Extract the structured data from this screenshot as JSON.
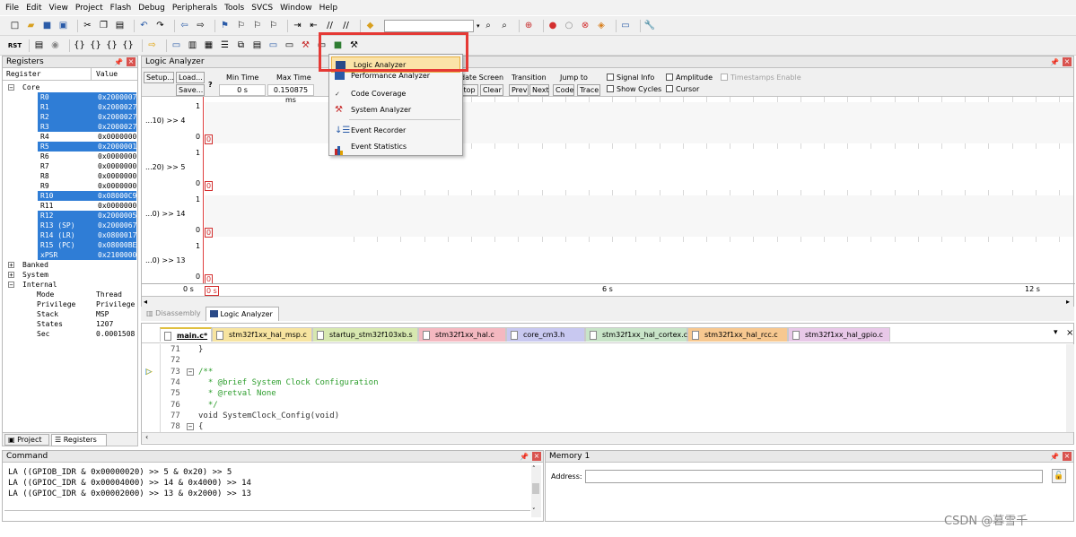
{
  "menu": [
    "File",
    "Edit",
    "View",
    "Project",
    "Flash",
    "Debug",
    "Peripherals",
    "Tools",
    "SVCS",
    "Window",
    "Help"
  ],
  "registers": {
    "title": "Registers",
    "col_register": "Register",
    "col_value": "Value",
    "group_core": "Core",
    "rows": [
      {
        "name": "R0",
        "value": "0x2000007",
        "selected": true
      },
      {
        "name": "R1",
        "value": "0x2000027",
        "selected": true
      },
      {
        "name": "R2",
        "value": "0x2000027",
        "selected": true
      },
      {
        "name": "R3",
        "value": "0x2000027",
        "selected": true
      },
      {
        "name": "R4",
        "value": "0x0000000",
        "selected": false
      },
      {
        "name": "R5",
        "value": "0x2000001",
        "selected": true
      },
      {
        "name": "R6",
        "value": "0x0000000",
        "selected": false
      },
      {
        "name": "R7",
        "value": "0x0000000",
        "selected": false
      },
      {
        "name": "R8",
        "value": "0x0000000",
        "selected": false
      },
      {
        "name": "R9",
        "value": "0x0000000",
        "selected": false
      },
      {
        "name": "R10",
        "value": "0x08000C9",
        "selected": true
      },
      {
        "name": "R11",
        "value": "0x0000000",
        "selected": false
      },
      {
        "name": "R12",
        "value": "0x2000005",
        "selected": true
      },
      {
        "name": "R13 (SP)",
        "value": "0x2000067",
        "selected": true
      },
      {
        "name": "R14 (LR)",
        "value": "0x0800017",
        "selected": true
      },
      {
        "name": "R15 (PC)",
        "value": "0x08000BE",
        "selected": true
      },
      {
        "name": "xPSR",
        "value": "0x2100000",
        "selected": true
      }
    ],
    "groups": [
      "Banked",
      "System",
      "Internal"
    ],
    "internal": [
      {
        "name": "Mode",
        "value": "Thread"
      },
      {
        "name": "Privilege",
        "value": "Privilege"
      },
      {
        "name": "Stack",
        "value": "MSP"
      },
      {
        "name": "States",
        "value": "1207"
      },
      {
        "name": "Sec",
        "value": "0.0001508"
      }
    ],
    "tab_project": "Project",
    "tab_registers": "Registers"
  },
  "la": {
    "title": "Logic Analyzer",
    "setup": "Setup...",
    "load": "Load...",
    "save": "Save...",
    "help": "?",
    "min_time_label": "Min Time",
    "min_time_value": "0 s",
    "max_time_label": "Max Time",
    "max_time_value": "0.150875 ms",
    "update_screen": "date Screen",
    "stop": "top",
    "clear": "Clear",
    "transition": "Transition",
    "prev": "Prev",
    "next": "Next",
    "jump_to": "Jump to",
    "code": "Code",
    "trace": "Trace",
    "signal_info": "Signal Info",
    "show_cycles": "Show Cycles",
    "amplitude": "Amplitude",
    "cursor": "Cursor",
    "timestamps": "Timestamps Enable",
    "signals": [
      {
        "label": "...10) >> 4",
        "hi": "1",
        "lo": "0"
      },
      {
        "label": "...20) >> 5",
        "hi": "1",
        "lo": "0"
      },
      {
        "label": "...0) >> 14",
        "hi": "1",
        "lo": "0"
      },
      {
        "label": "...0) >> 13",
        "hi": "1",
        "lo": "0"
      }
    ],
    "marker": "0",
    "time_left": "0 s",
    "time_cursor": "0 s",
    "time_mid": "6 s",
    "time_right": "12 s"
  },
  "dropdown": {
    "items": [
      "Logic Analyzer",
      "Performance Analyzer",
      "Code Coverage",
      "System Analyzer",
      "Event Recorder",
      "Event Statistics"
    ]
  },
  "bottom_tabs": {
    "disassembly": "Disassembly",
    "logic_analyzer": "Logic Analyzer"
  },
  "file_tabs": [
    {
      "name": "main.c*",
      "color": "#f7e4a0",
      "active": true
    },
    {
      "name": "stm32f1xx_hal_msp.c",
      "color": "#f7e4a0"
    },
    {
      "name": "startup_stm32f103xb.s",
      "color": "#d7e8b0"
    },
    {
      "name": "stm32f1xx_hal.c",
      "color": "#f4b8c0"
    },
    {
      "name": "core_cm3.h",
      "color": "#c8c8f0"
    },
    {
      "name": "stm32f1xx_hal_cortex.c",
      "color": "#c8e4c8"
    },
    {
      "name": "stm32f1xx_hal_rcc.c",
      "color": "#f7c890"
    },
    {
      "name": "stm32f1xx_hal_gpio.c",
      "color": "#e8c8e8"
    }
  ],
  "code_lines": [
    {
      "num": "71",
      "text": "}"
    },
    {
      "num": "72",
      "text": ""
    },
    {
      "num": "73",
      "text": "/**"
    },
    {
      "num": "74",
      "text": "  * @brief System Clock Configuration"
    },
    {
      "num": "75",
      "text": "  * @retval None"
    },
    {
      "num": "76",
      "text": "  */"
    },
    {
      "num": "77",
      "text": "void SystemClock_Config(void)"
    },
    {
      "num": "78",
      "text": "{"
    }
  ],
  "command": {
    "title": "Command",
    "lines": [
      "LA ((GPIOB_IDR & 0x00000020) >> 5 & 0x20) >> 5",
      "LA ((GPIOC_IDR & 0x00004000) >> 14 & 0x4000) >> 14",
      "LA ((GPIOC_IDR & 0x00002000) >> 13 & 0x2000) >> 13"
    ]
  },
  "memory": {
    "title": "Memory 1",
    "address_label": "Address:",
    "address_value": ""
  },
  "watermark": "CSDN @暮雪千",
  "colors": {
    "highlight_box": "#e53935",
    "selection": "#2f7dd6"
  }
}
